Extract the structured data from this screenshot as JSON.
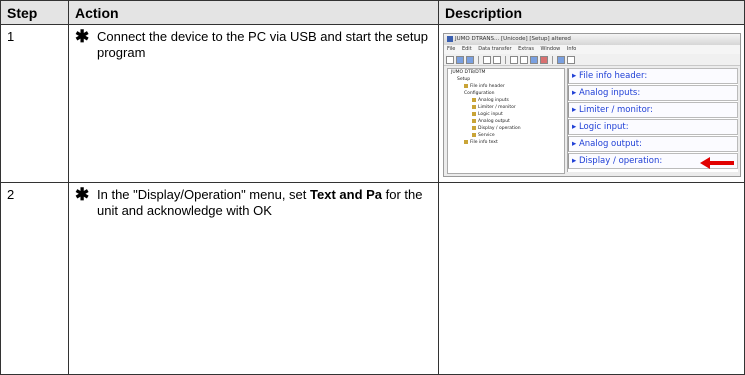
{
  "table": {
    "headers": [
      "Step",
      "Action",
      "Description"
    ],
    "rows": [
      {
        "step": "1",
        "bullet": "✱",
        "action": "Connect the device to the PC via USB and start the setup program"
      },
      {
        "step": "2",
        "bullet": "✱",
        "action_before": "In the \"Display/Operation\" menu, set ",
        "action_bold": "Text and Pa",
        "action_after": " for the unit and acknowledge with OK"
      }
    ]
  },
  "screenshot": {
    "window_title": "JUMO DTRANS... [Unicode] [Setup] altered",
    "menu": [
      "File",
      "Edit",
      "Data transfer",
      "Extras",
      "Window",
      "Info"
    ],
    "tree": {
      "root": "JUMO DTB/DTM",
      "setup": "Setup",
      "file_info_header": "File info header",
      "configuration": "Configuration",
      "config_items": [
        "Analog inputs",
        "Limiter / monitor",
        "Logic input",
        "Analog output",
        "Display / operation",
        "Service"
      ],
      "file_info_text": "File info text"
    },
    "sections": [
      "File info header:",
      "Analog inputs:",
      "Limiter / monitor:",
      "Logic input:",
      "Analog output:",
      "Display / operation:"
    ],
    "highlight_color": "#e10000",
    "link_color": "#1f3fd6"
  }
}
